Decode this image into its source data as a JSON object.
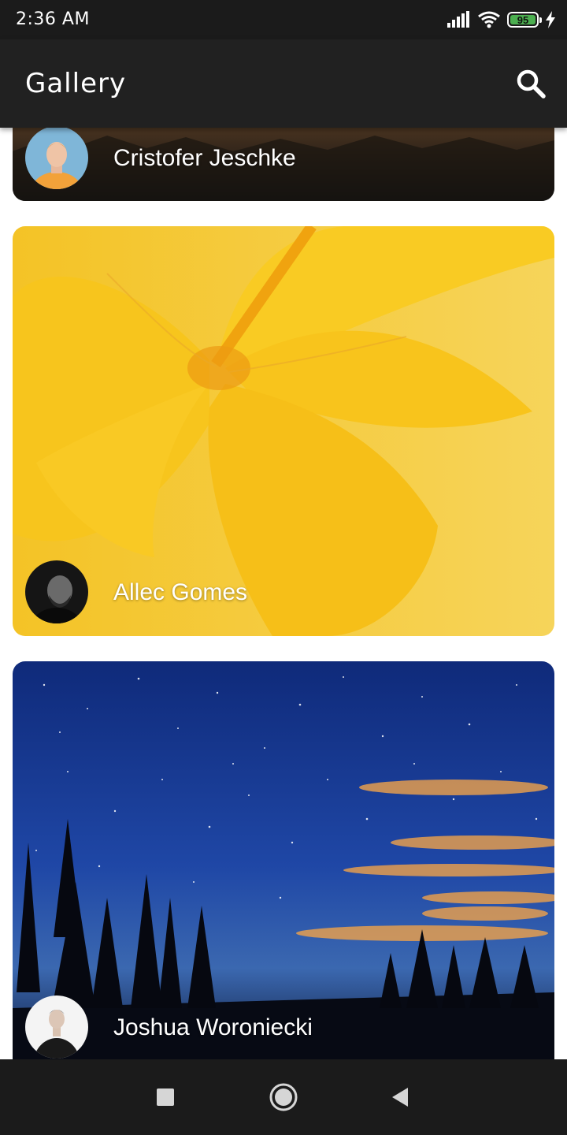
{
  "status_bar": {
    "time": "2:36 AM",
    "battery_level": "95",
    "icons": [
      "signal-icon",
      "wifi-icon",
      "battery-icon",
      "charging-icon"
    ]
  },
  "app_bar": {
    "title": "Gallery",
    "search_icon": "search-icon"
  },
  "cards": [
    {
      "author": "Cristofer Jeschke",
      "photo": "dark landscape"
    },
    {
      "author": "Allec Gomes",
      "photo": "yellow flower"
    },
    {
      "author": "Joshua Woroniecki",
      "photo": "night sky with trees"
    }
  ],
  "nav_bar": {
    "buttons": [
      "recents-icon",
      "home-icon",
      "back-icon"
    ]
  },
  "colors": {
    "status_bar": "#1b1b1b",
    "app_bar": "#212121",
    "battery_fill": "#4caf50",
    "flower_yellow": "#f5c518",
    "night_blue": "#1a3a8a"
  }
}
